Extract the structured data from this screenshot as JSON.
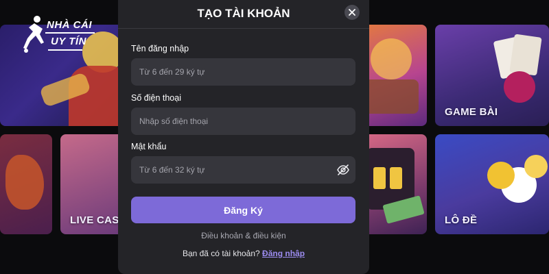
{
  "background": {
    "logo": {
      "line1": "NHÀ CÁI",
      "line2": "UY TÍN"
    },
    "tiles": {
      "game_bai": "GAME BÀI",
      "live_casino": "LIVE CASI",
      "lo_de": "LÔ ĐỀ"
    }
  },
  "modal": {
    "title": "TẠO TÀI KHOẢN",
    "fields": {
      "username": {
        "label": "Tên đăng nhập",
        "placeholder": "Từ 6 đến 29 ký tự",
        "value": ""
      },
      "phone": {
        "label": "Số điện thoại",
        "placeholder": "Nhập số điện thoại",
        "value": ""
      },
      "password": {
        "label": "Mật khẩu",
        "placeholder": "Từ 6 đến 32 ký tự",
        "value": ""
      }
    },
    "submit_label": "Đăng Ký",
    "terms_text": "Điều khoản & điều kiện",
    "login_prompt": "Bạn đã có tài khoản?",
    "login_link": "Đăng nhập"
  },
  "colors": {
    "modal_bg": "#242428",
    "input_bg": "#36363c",
    "accent": "#7d6ad8",
    "link": "#9c8cf0"
  },
  "icons": [
    "close-icon",
    "eye-off-icon",
    "logo-player-icon"
  ]
}
